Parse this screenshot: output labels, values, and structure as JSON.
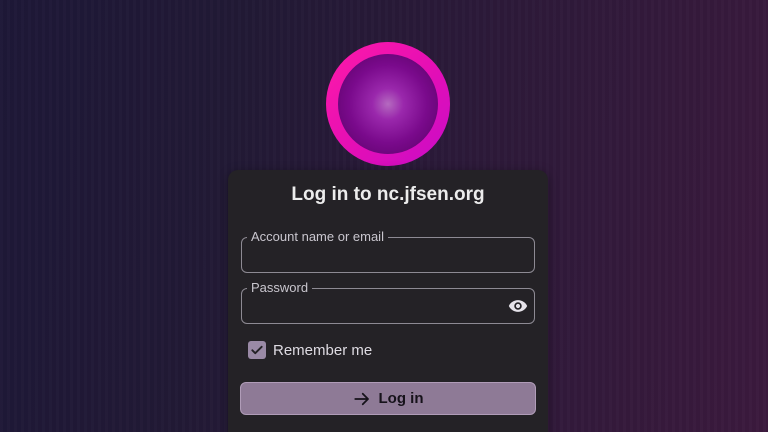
{
  "login": {
    "title": "Log in to nc.jfsen.org",
    "account_label": "Account name or email",
    "account_value": "",
    "password_label": "Password",
    "password_value": "",
    "remember_label": "Remember me",
    "remember_checked": true,
    "submit_label": "Log in"
  },
  "icons": {
    "logo": "logo-icon",
    "password_toggle": "eye-icon",
    "checkbox": "checkmark-icon",
    "submit": "arrow-right-icon"
  },
  "colors": {
    "logo_ring": "#ff1aa8",
    "logo_core": "#7a0a8c",
    "card": "#242226",
    "button": "#8e7a96",
    "checkbox": "#9a8aa6"
  }
}
